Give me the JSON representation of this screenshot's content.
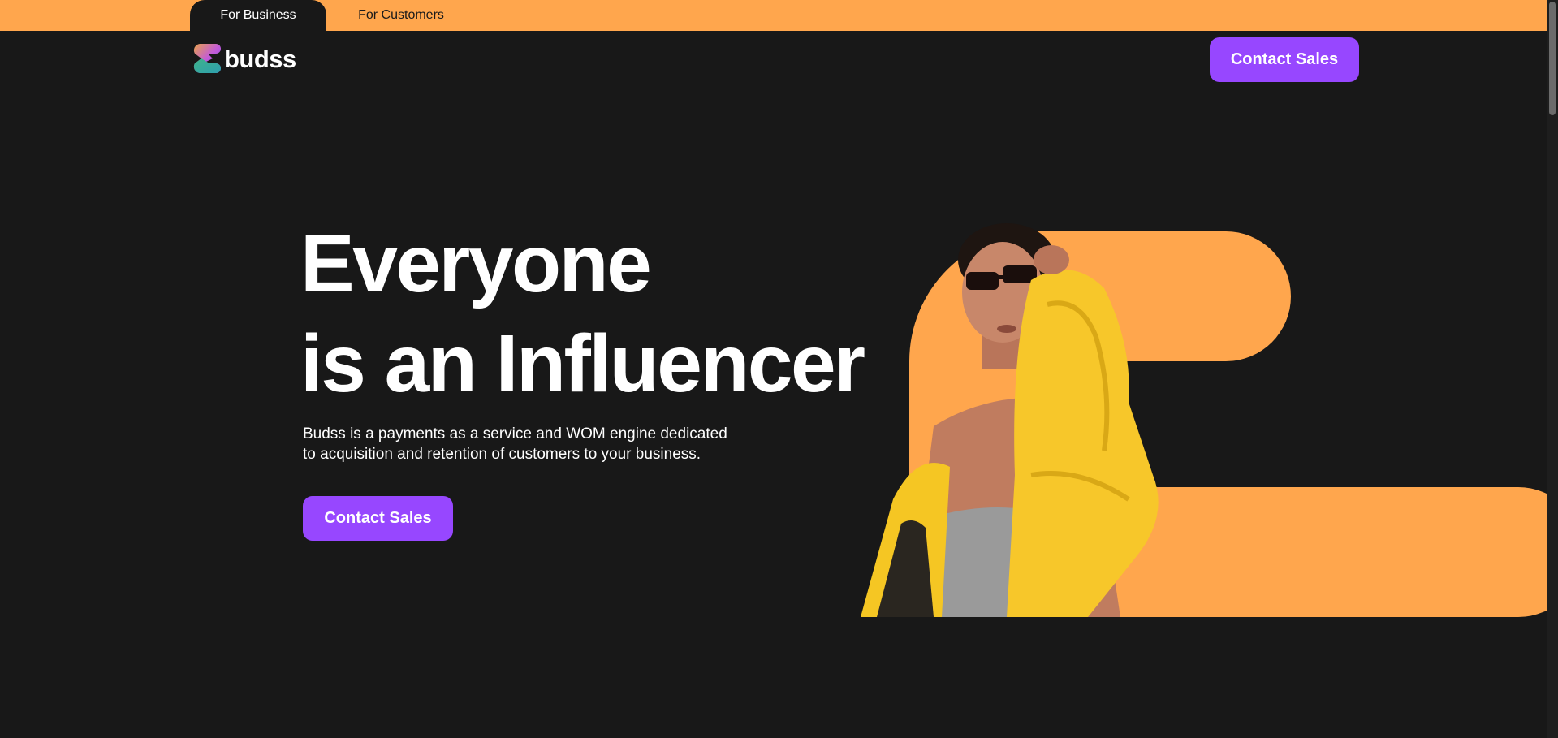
{
  "audience_tabs": {
    "business": "For Business",
    "customers": "For Customers"
  },
  "logo": {
    "wordmark": "budss"
  },
  "nav": {
    "contact_label": "Contact Sales"
  },
  "hero": {
    "headline_line1": "Everyone",
    "headline_line2": "is an Influencer",
    "sub_line1": "Budss is a payments as a service and WOM engine dedicated",
    "sub_line2": "to acquisition and retention of customers to your business.",
    "cta_label": "Contact Sales",
    "image_icon": "woman-in-yellow-jacket-with-sunglasses"
  },
  "colors": {
    "accent_orange": "#FFA64D",
    "button_purple": "#9747FF",
    "background": "#181818",
    "text": "#FFFFFF"
  }
}
